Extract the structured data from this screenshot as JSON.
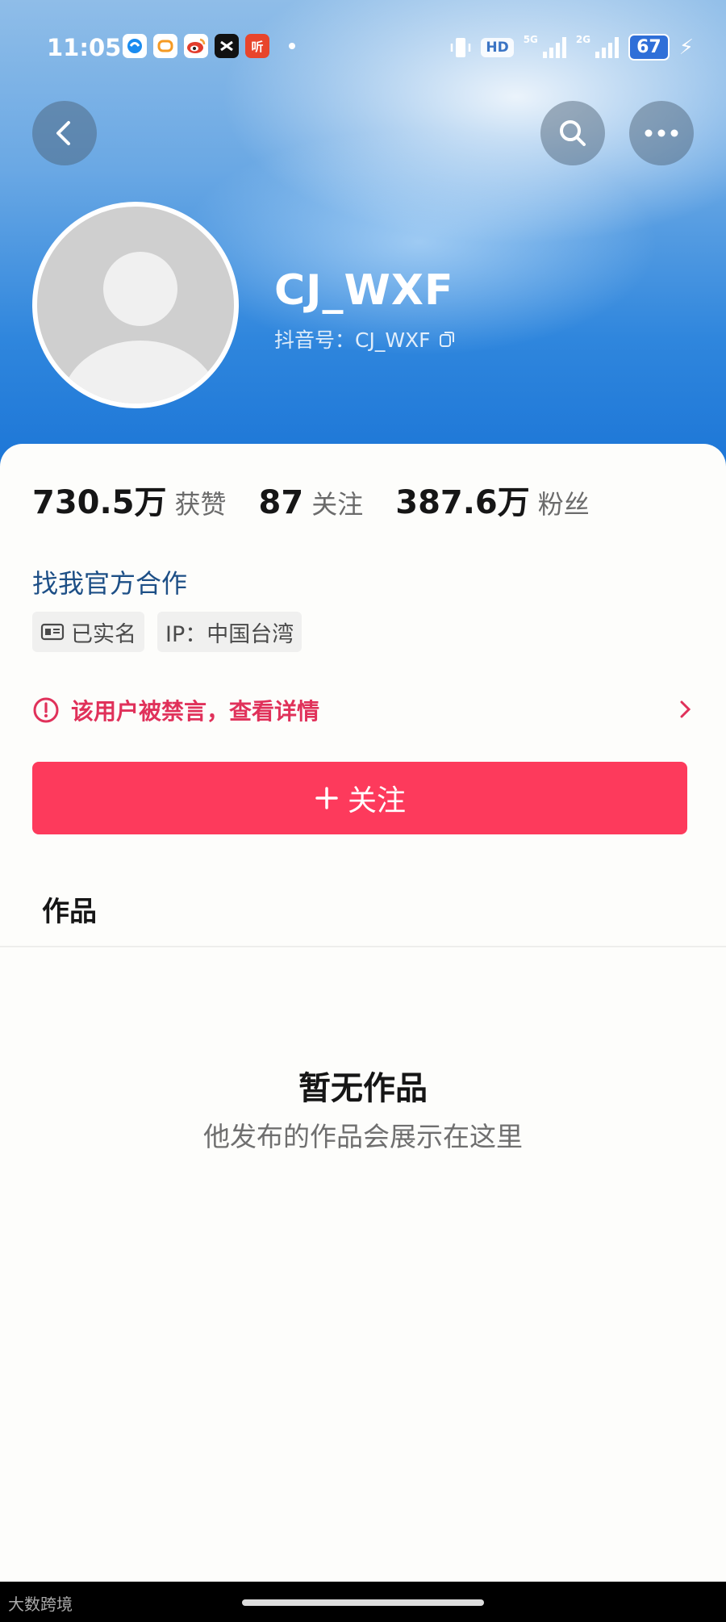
{
  "status_bar": {
    "time": "11:05",
    "apps": [
      "browser-app",
      "taxi-app",
      "weibo-app",
      "capcut-app",
      "listen-app"
    ],
    "app_listen_label": "听",
    "hd": "HD",
    "net1": "5G",
    "net2": "2G",
    "battery": "67",
    "colors": {
      "weibo": "#f4a13a",
      "capcut": "#111111",
      "listen": "#e8452c",
      "taxi": "#f59a23",
      "browser": "#1a8cf0"
    }
  },
  "profile": {
    "username": "CJ_WXF",
    "douyin_id": "抖音号：CJ_WXF"
  },
  "stats": [
    {
      "value": "730.5万",
      "label": "获赞"
    },
    {
      "value": "87",
      "label": "关注"
    },
    {
      "value": "387.6万",
      "label": "粉丝"
    }
  ],
  "cooperation_link": "找我官方合作",
  "tags": {
    "verified": "已实名",
    "ip": "IP：中国台湾"
  },
  "ban_notice": {
    "text": "该用户被禁言，查看详情",
    "color": "#e0315a"
  },
  "follow_button": {
    "label": "关注",
    "color": "#fd3a5c"
  },
  "tabs": {
    "works": "作品"
  },
  "empty_state": {
    "title": "暂无作品",
    "subtitle": "他发布的作品会展示在这里"
  },
  "watermark": "大数跨境"
}
